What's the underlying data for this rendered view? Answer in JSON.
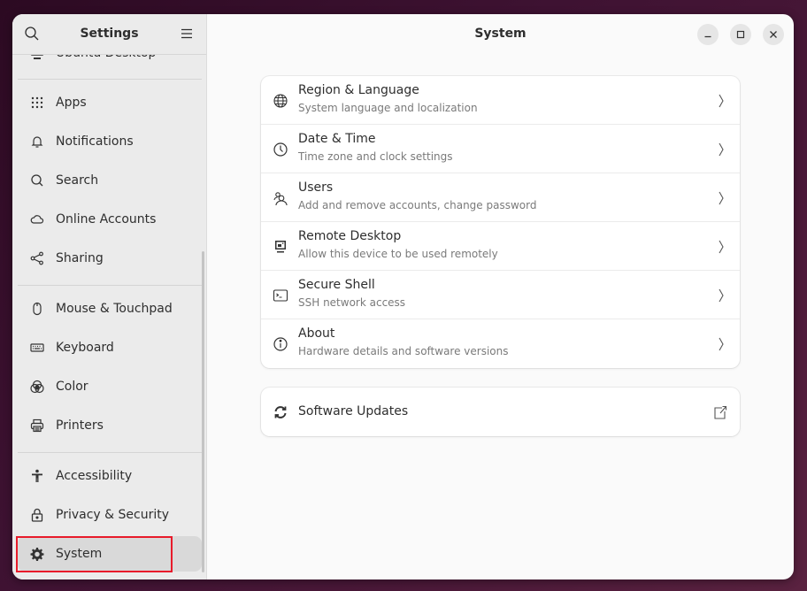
{
  "window": {
    "sidebar_title": "Settings",
    "main_title": "System",
    "controls": {
      "minimize": "minimize",
      "maximize": "maximize",
      "close": "close"
    }
  },
  "sidebar": {
    "items": [
      {
        "label": "Ubuntu Desktop",
        "icon": "desktop-icon"
      },
      {
        "label": "Apps",
        "icon": "apps-grid-icon"
      },
      {
        "label": "Notifications",
        "icon": "bell-icon"
      },
      {
        "label": "Search",
        "icon": "search-icon"
      },
      {
        "label": "Online Accounts",
        "icon": "cloud-icon"
      },
      {
        "label": "Sharing",
        "icon": "share-icon"
      },
      {
        "label": "Mouse & Touchpad",
        "icon": "mouse-icon"
      },
      {
        "label": "Keyboard",
        "icon": "keyboard-icon"
      },
      {
        "label": "Color",
        "icon": "color-icon"
      },
      {
        "label": "Printers",
        "icon": "printer-icon"
      },
      {
        "label": "Accessibility",
        "icon": "accessibility-icon"
      },
      {
        "label": "Privacy & Security",
        "icon": "lock-icon"
      },
      {
        "label": "System",
        "icon": "gear-icon",
        "selected": true
      }
    ]
  },
  "main": {
    "rows": [
      {
        "title": "Region & Language",
        "subtitle": "System language and localization",
        "icon": "globe-icon"
      },
      {
        "title": "Date & Time",
        "subtitle": "Time zone and clock settings",
        "icon": "clock-icon"
      },
      {
        "title": "Users",
        "subtitle": "Add and remove accounts, change password",
        "icon": "users-icon"
      },
      {
        "title": "Remote Desktop",
        "subtitle": "Allow this device to be used remotely",
        "icon": "remote-desktop-icon"
      },
      {
        "title": "Secure Shell",
        "subtitle": "SSH network access",
        "icon": "terminal-icon"
      },
      {
        "title": "About",
        "subtitle": "Hardware details and software versions",
        "icon": "info-icon"
      }
    ],
    "software_updates": {
      "title": "Software Updates",
      "icon": "refresh-icon"
    }
  },
  "colors": {
    "highlight": "#e81b2b",
    "selected_bg": "#d9d9d9"
  }
}
